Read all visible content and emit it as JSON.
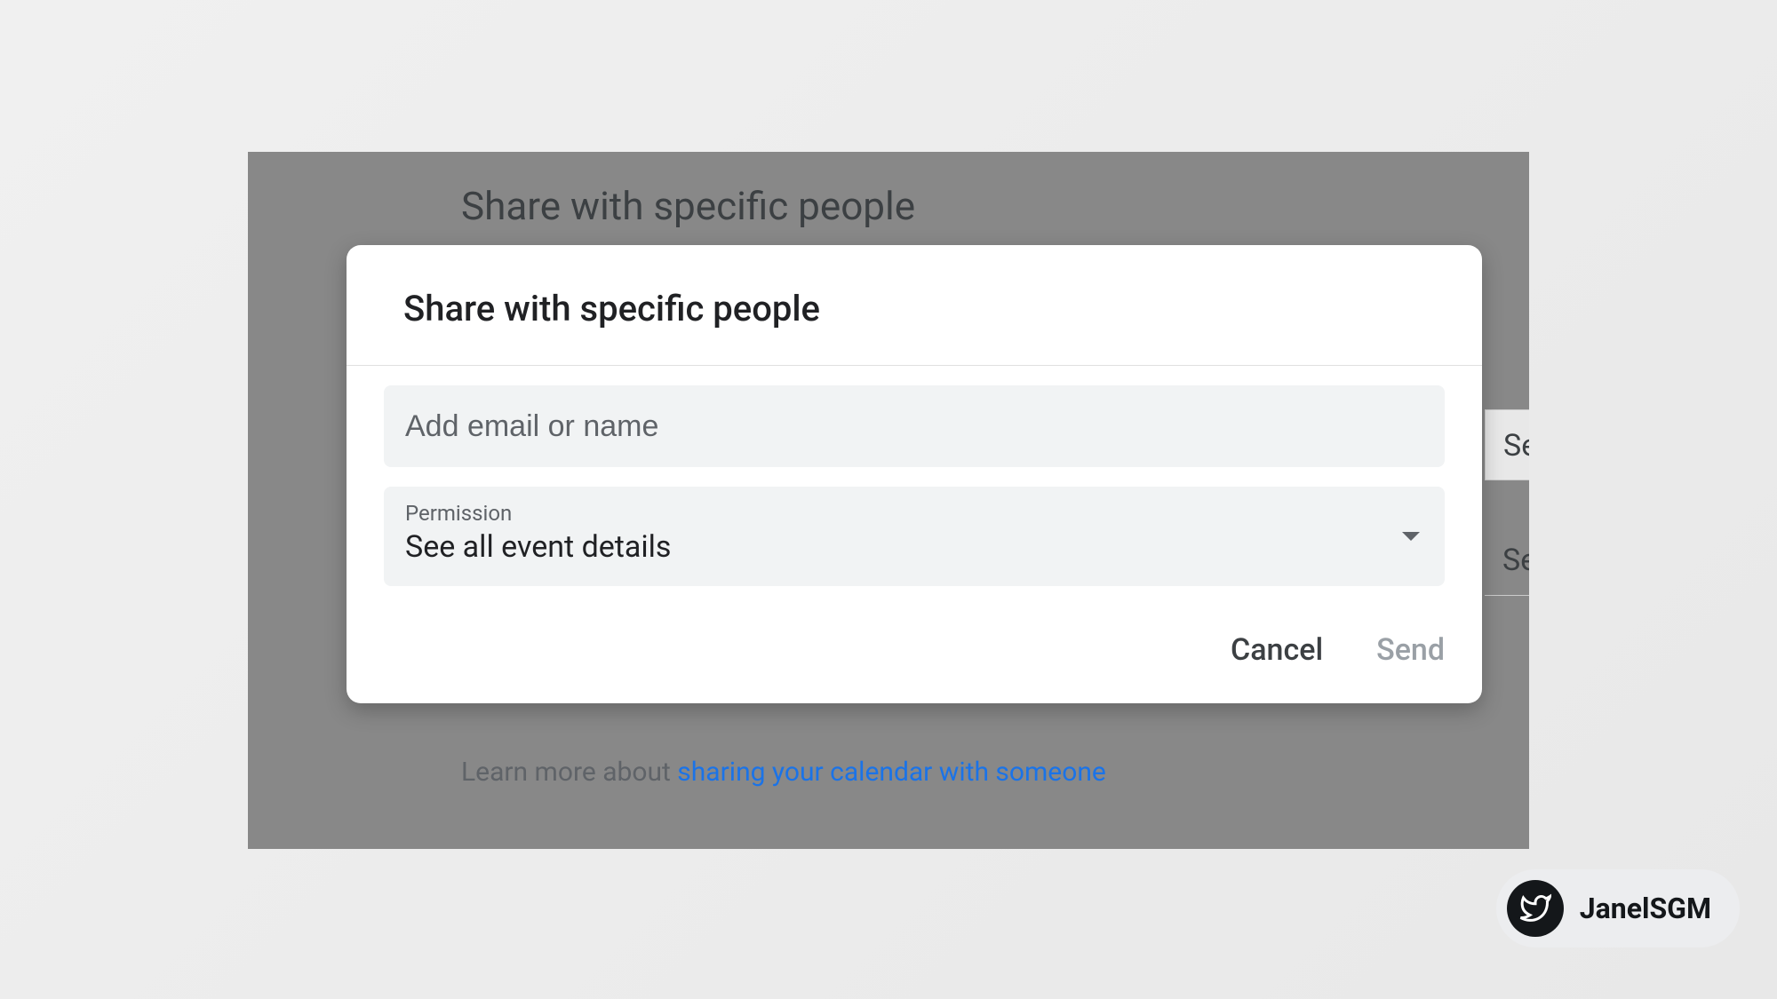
{
  "background": {
    "heading": "Share with specific people",
    "learn_more_prefix": "Learn more about ",
    "learn_more_link": "sharing your calendar with someone",
    "right_fragment_1": "Se",
    "right_fragment_2": "Se"
  },
  "dialog": {
    "title": "Share with specific people",
    "email_placeholder": "Add email or name",
    "permission_label": "Permission",
    "permission_value": "See all event details",
    "cancel_label": "Cancel",
    "send_label": "Send"
  },
  "badge": {
    "handle": "JanelSGM"
  }
}
